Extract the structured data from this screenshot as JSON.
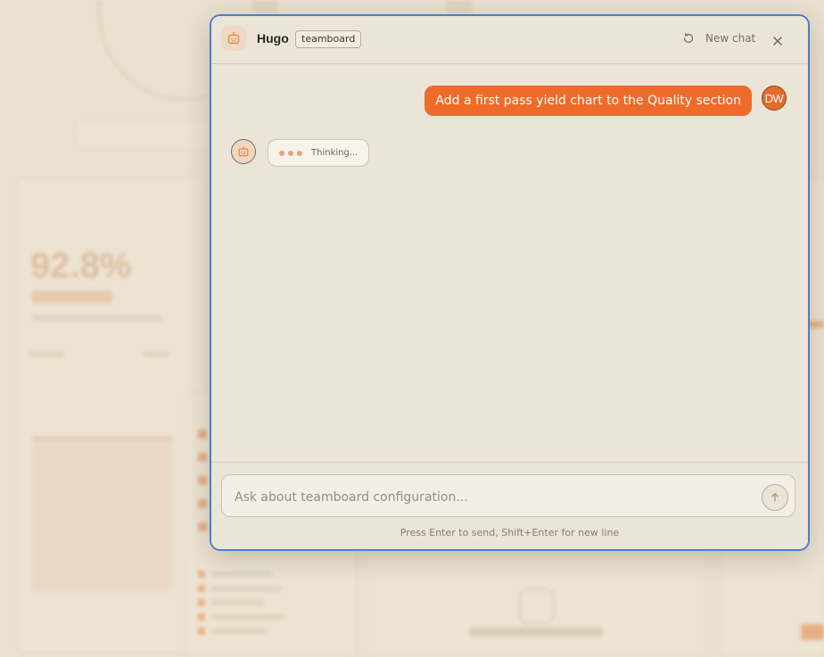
{
  "chat": {
    "assistant_name": "Hugo",
    "context_tag": "teamboard",
    "new_chat_label": "New chat",
    "user_message": "Add a first pass yield chart to the Quality section",
    "user_initials": "DW",
    "thinking_label": "Thinking...",
    "input_placeholder": "Ask about teamboard configuration...",
    "input_value": "",
    "hint": "Press Enter to send, Shift+Enter for new line"
  },
  "icons": {
    "assistant": "robot-icon",
    "new_chat": "history-icon",
    "close": "close-icon",
    "send": "arrow-up-icon"
  },
  "colors": {
    "accent": "#ef6b2b",
    "modal_border": "#4a7fd0",
    "modal_bg": "#ebe5d8"
  }
}
